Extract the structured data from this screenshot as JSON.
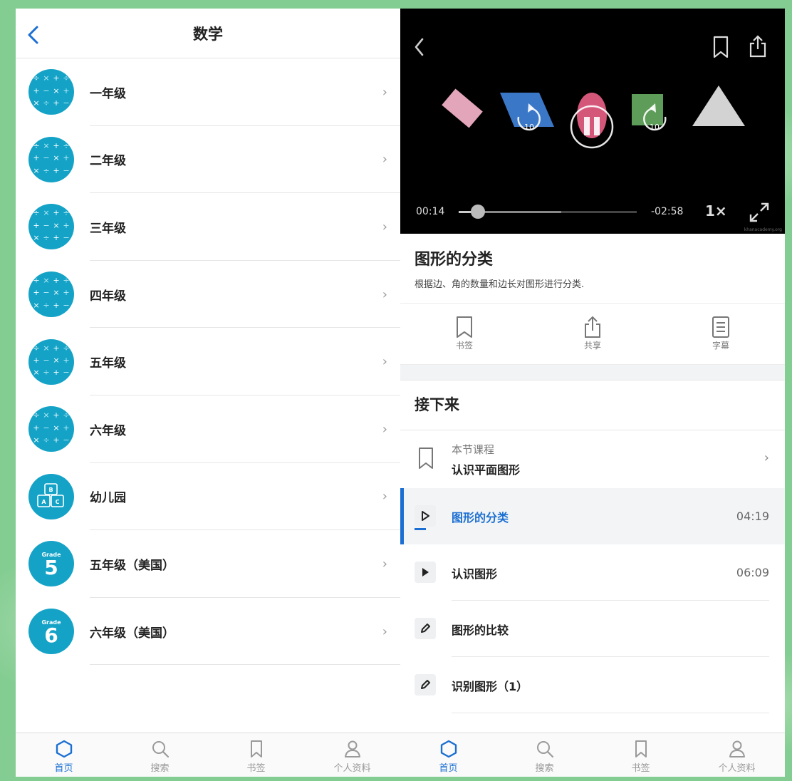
{
  "left": {
    "title": "数学",
    "grades": [
      {
        "label": "一年级",
        "icon": "math-symbols-icon"
      },
      {
        "label": "二年级",
        "icon": "math-symbols-icon"
      },
      {
        "label": "三年级",
        "icon": "math-symbols-icon"
      },
      {
        "label": "四年级",
        "icon": "math-symbols-icon"
      },
      {
        "label": "五年级",
        "icon": "math-symbols-icon"
      },
      {
        "label": "六年级",
        "icon": "math-symbols-icon"
      },
      {
        "label": "幼儿园",
        "icon": "blocks-icon",
        "icon_text": "ABC"
      },
      {
        "label": "五年级（美国）",
        "icon": "grade-badge-icon",
        "badge_word": "Grade",
        "badge_num": "5"
      },
      {
        "label": "六年级（美国）",
        "icon": "grade-badge-icon",
        "badge_word": "Grade",
        "badge_num": "6"
      }
    ],
    "tabs": [
      {
        "label": "首页",
        "icon": "home-icon",
        "active": true
      },
      {
        "label": "搜索",
        "icon": "search-icon"
      },
      {
        "label": "书签",
        "icon": "bookmark-icon"
      },
      {
        "label": "个人资料",
        "icon": "profile-icon"
      }
    ]
  },
  "right": {
    "video": {
      "current_time": "00:14",
      "remaining_time": "-02:58",
      "speed": "1×",
      "progress_fraction": 0.08,
      "buffered_fraction": 0.56,
      "credit": "khanacademy.org"
    },
    "lesson": {
      "title": "图形的分类",
      "description": "根据边、角的数量和边长对图形进行分类."
    },
    "actions": [
      {
        "label": "书签",
        "icon": "bookmark-icon"
      },
      {
        "label": "共享",
        "icon": "share-icon"
      },
      {
        "label": "字幕",
        "icon": "transcript-icon"
      }
    ],
    "next": {
      "title": "接下来",
      "course_sub": "本节课程",
      "course_name": "认识平面图形",
      "items": [
        {
          "name": "图形的分类",
          "duration": "04:19",
          "type": "video",
          "active": true
        },
        {
          "name": "认识图形",
          "duration": "06:09",
          "type": "video"
        },
        {
          "name": "图形的比较",
          "duration": "",
          "type": "exercise"
        },
        {
          "name": "识别图形（1）",
          "duration": "",
          "type": "exercise"
        }
      ]
    },
    "tabs": [
      {
        "label": "首页",
        "icon": "home-icon",
        "active": true
      },
      {
        "label": "搜索",
        "icon": "search-icon"
      },
      {
        "label": "书签",
        "icon": "bookmark-icon"
      },
      {
        "label": "个人资料",
        "icon": "profile-icon"
      }
    ]
  },
  "colors": {
    "accent": "#1b6fd2",
    "grade_icon": "#14a3c7",
    "background": "#84cd92"
  }
}
